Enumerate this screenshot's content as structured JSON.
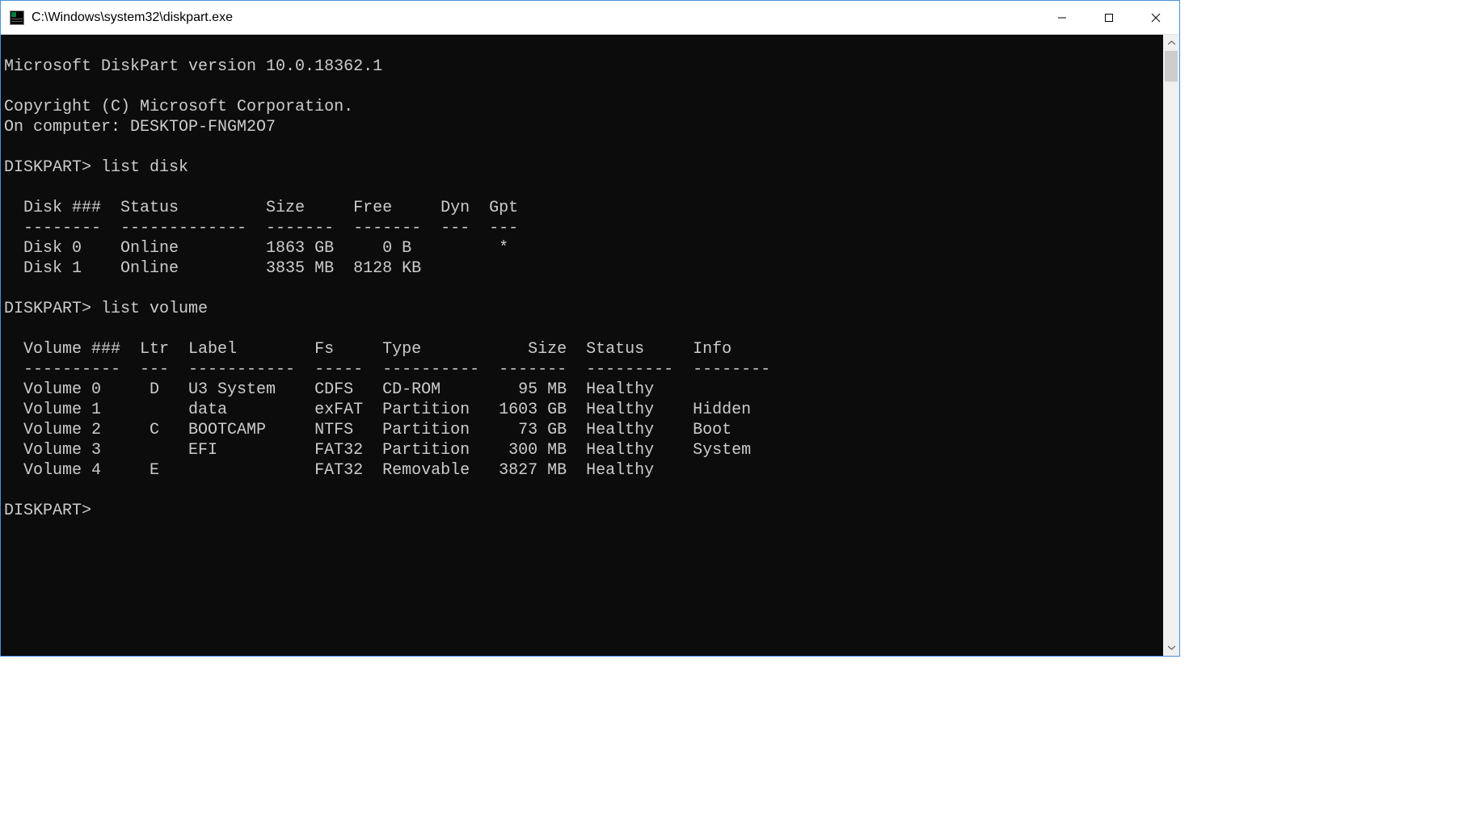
{
  "window": {
    "title": "C:\\Windows\\system32\\diskpart.exe"
  },
  "intro": {
    "version": "Microsoft DiskPart version 10.0.18362.1",
    "copyright": "Copyright (C) Microsoft Corporation.",
    "computer": "On computer: DESKTOP-FNGM2O7"
  },
  "prompt": "DISKPART>",
  "cmd1": "list disk",
  "disk_table": {
    "headers": [
      "Disk ###",
      "Status",
      "Size",
      "Free",
      "Dyn",
      "Gpt"
    ],
    "dividers": [
      "--------",
      "-------------",
      "-------",
      "-------",
      "---",
      "---"
    ],
    "rows": [
      {
        "disk": "Disk 0",
        "status": "Online",
        "size": "1863 GB",
        "free": "0 B",
        "dyn": "",
        "gpt": "*"
      },
      {
        "disk": "Disk 1",
        "status": "Online",
        "size": "3835 MB",
        "free": "8128 KB",
        "dyn": "",
        "gpt": ""
      }
    ]
  },
  "cmd2": "list volume",
  "volume_table": {
    "headers": [
      "Volume ###",
      "Ltr",
      "Label",
      "Fs",
      "Type",
      "Size",
      "Status",
      "Info"
    ],
    "dividers": [
      "----------",
      "---",
      "-----------",
      "-----",
      "----------",
      "-------",
      "---------",
      "--------"
    ],
    "rows": [
      {
        "vol": "Volume 0",
        "ltr": "D",
        "label": "U3 System",
        "fs": "CDFS",
        "type": "CD-ROM",
        "size": "95 MB",
        "status": "Healthy",
        "info": ""
      },
      {
        "vol": "Volume 1",
        "ltr": "",
        "label": "data",
        "fs": "exFAT",
        "type": "Partition",
        "size": "1603 GB",
        "status": "Healthy",
        "info": "Hidden"
      },
      {
        "vol": "Volume 2",
        "ltr": "C",
        "label": "BOOTCAMP",
        "fs": "NTFS",
        "type": "Partition",
        "size": "73 GB",
        "status": "Healthy",
        "info": "Boot"
      },
      {
        "vol": "Volume 3",
        "ltr": "",
        "label": "EFI",
        "fs": "FAT32",
        "type": "Partition",
        "size": "300 MB",
        "status": "Healthy",
        "info": "System"
      },
      {
        "vol": "Volume 4",
        "ltr": "E",
        "label": "",
        "fs": "FAT32",
        "type": "Removable",
        "size": "3827 MB",
        "status": "Healthy",
        "info": ""
      }
    ]
  }
}
